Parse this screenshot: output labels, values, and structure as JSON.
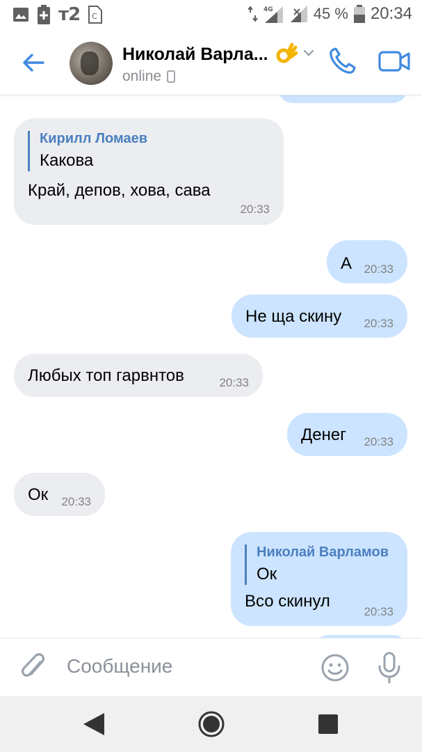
{
  "status_bar": {
    "carrier": "т2",
    "network_label": "4G",
    "battery_percent": "45 %",
    "time": "20:34"
  },
  "header": {
    "contact_name": "Николай Варла...",
    "status": "online",
    "icons": [
      "back-arrow-icon",
      "avatar",
      "ok-hand-emoji-icon",
      "chevron-down-icon",
      "phone-icon",
      "video-camera-icon",
      "mobile-device-icon"
    ]
  },
  "messages": [
    {
      "direction": "in",
      "reply_to": {
        "name": "Кирилл Ломаев",
        "text": "Какова"
      },
      "text": "Край, депов, хова, сава",
      "time": "20:33"
    },
    {
      "direction": "out",
      "text": "А",
      "time": "20:33"
    },
    {
      "direction": "out",
      "text": "Не ща скину",
      "time": "20:33"
    },
    {
      "direction": "in",
      "text": "Любых топ гарвнтов",
      "time": "20:33"
    },
    {
      "direction": "out",
      "text": "Денег",
      "time": "20:33"
    },
    {
      "direction": "in",
      "text": "Ок",
      "time": "20:33"
    },
    {
      "direction": "out",
      "reply_to": {
        "name": "Николай Варламов",
        "text": "Ок"
      },
      "text": "Всо скинул",
      "time": "20:33"
    }
  ],
  "composer": {
    "placeholder": "Сообщение"
  },
  "colors": {
    "accent": "#3f8ae0",
    "incoming_bubble": "#ebedf0",
    "outgoing_bubble": "#cce4ff",
    "reply_name": "#4a7fc0"
  }
}
